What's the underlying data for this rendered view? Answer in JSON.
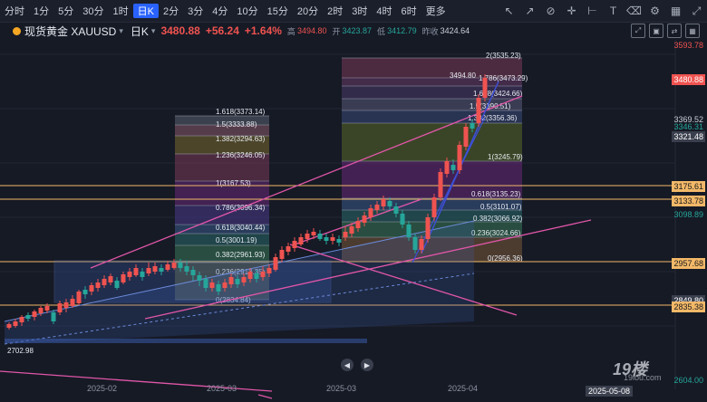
{
  "toolbar": {
    "timeframes": [
      "分时",
      "1分",
      "5分",
      "30分",
      "1时",
      "日K",
      "2分",
      "3分",
      "4分",
      "10分",
      "15分",
      "20分",
      "2时",
      "3时",
      "4时",
      "6时",
      "更多"
    ],
    "active_index": 5,
    "tool_icons": [
      "cursor-tool-icon",
      "arrow-tool-icon",
      "measure-tool-icon",
      "crosshair-tool-icon",
      "ruler-tool-icon",
      "text-tool-icon",
      "erase-tool-icon",
      "settings-icon",
      "layout-icon",
      "expand-icon"
    ]
  },
  "instrument": {
    "name": "现货黄金 XAUUSD",
    "period": "日K",
    "price": "3480.88",
    "change": "+56.24",
    "change_pct": "+1.64%",
    "high_label": "高",
    "high": "3494.80",
    "open_label": "开",
    "open": "3423.87",
    "low_label": "低",
    "low": "3412.79",
    "prev_label": "昨收",
    "prev": "3424.64"
  },
  "price_axis": [
    {
      "text": "3593.78",
      "color": "#ef5350",
      "bg": "none"
    },
    {
      "text": "3480.88",
      "color": "#ffffff",
      "bg": "#ef5350"
    },
    {
      "text": "3369.52",
      "color": "#c9ced8",
      "bg": "none"
    },
    {
      "text": "3346.31",
      "color": "#26a69a",
      "bg": "none"
    },
    {
      "text": "3321.48",
      "color": "#ffffff",
      "bg": "#3a3f4d"
    },
    {
      "text": "3175.61",
      "color": "#1a1a1a",
      "bg": "#f3b868"
    },
    {
      "text": "3133.78",
      "color": "#1a1a1a",
      "bg": "#f3b868"
    },
    {
      "text": "3098.89",
      "color": "#26a69a",
      "bg": "none"
    },
    {
      "text": "2957.68",
      "color": "#1a1a1a",
      "bg": "#f3b868"
    },
    {
      "text": "2849.80",
      "color": "#ffffff",
      "bg": "#3a3f4d"
    },
    {
      "text": "2835.38",
      "color": "#1a1a1a",
      "bg": "#f3b868"
    },
    {
      "text": "2604.00",
      "color": "#26a69a",
      "bg": "none"
    }
  ],
  "dates": [
    "2025-02",
    "2025-03",
    "2025-03",
    "2025-04"
  ],
  "date_cursor": "2025-05-08",
  "low_marker": "2702.98",
  "fib_left": [
    "1.618(3373.14)",
    "1.5(3333.88)",
    "1.382(3294.63)",
    "1.236(3246.05)",
    "1(3167.53)",
    "0.786(3096.34)",
    "0.618(3040.44)",
    "0.5(3001.19)",
    "0.382(2961.93)",
    "0.236(2913.35)",
    "0(2834.84)"
  ],
  "fib_right": [
    "2(3535.23)",
    "3494.80",
    "1.786(3473.29)",
    "1.618(3424.66)",
    "1.5(3390.51)",
    "1.382(3356.36)",
    "1(3245.79)",
    "0.618(3135.23)",
    "0.5(3101.07)",
    "0.382(3066.92)",
    "0.236(3024.66)",
    "0(2956.36)"
  ],
  "watermark": "19楼",
  "watermark_sub": "19lou.com",
  "colors": {
    "up": "#ef5350",
    "down": "#26a69a",
    "accent": "#2962ff",
    "fib_line": "#f3b868"
  }
}
